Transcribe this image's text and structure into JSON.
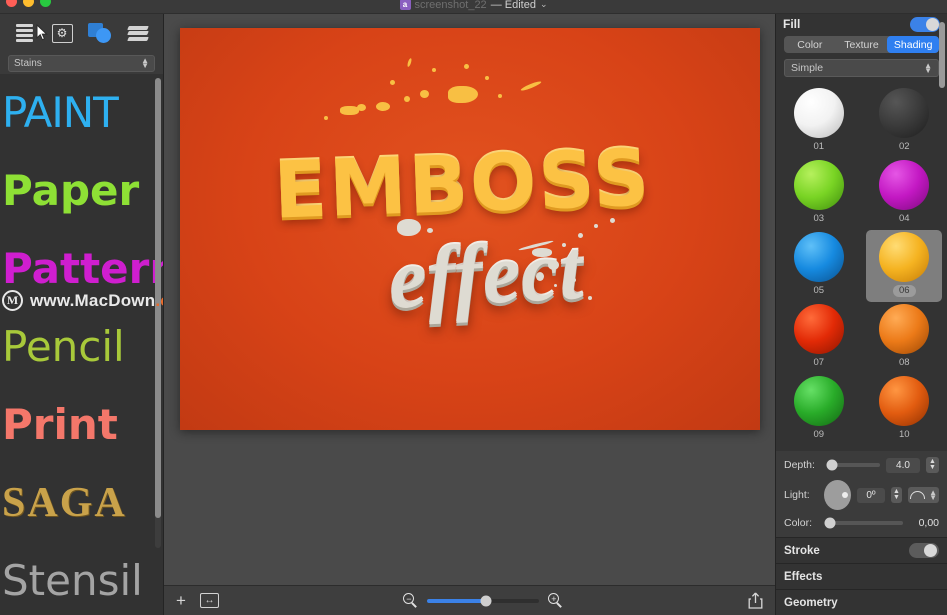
{
  "window": {
    "doc_icon_letter": "a",
    "doc_name": "screenshot_22",
    "edited_suffix": "— Edited",
    "chevron": "⌄"
  },
  "left_toolbar": {
    "icons": [
      {
        "name": "list-icon",
        "label": "List"
      },
      {
        "name": "settings-box-icon",
        "label": "Settings"
      },
      {
        "name": "shapes-icon",
        "label": "Shapes"
      },
      {
        "name": "layers-icon",
        "label": "Layers"
      }
    ]
  },
  "preset": {
    "value": "Stains",
    "stepper": "⌃⌄"
  },
  "styles": [
    {
      "label": "PAINT",
      "cls": "s-paint"
    },
    {
      "label": "Paper",
      "cls": "s-paper"
    },
    {
      "label": "Pattern",
      "cls": "s-pattern"
    },
    {
      "label": "Pencil",
      "cls": "s-pencil"
    },
    {
      "label": "Print",
      "cls": "s-print"
    },
    {
      "label": "SAGA",
      "cls": "s-saga"
    },
    {
      "label": "Stensil",
      "cls": "s-stensil"
    }
  ],
  "watermark": {
    "logo_letter": "M",
    "text": "www.MacDown",
    "tld": ".com"
  },
  "canvas": {
    "headline": "EMBOSS",
    "subline": "effect",
    "background_color": "#d84317",
    "headline_color": "#fcc244",
    "subline_color": "#dedbd2"
  },
  "bottom_bar": {
    "add_label": "+",
    "fit_label": "↔",
    "zoom_out_sign": "−",
    "zoom_in_sign": "+",
    "zoom_percent": 52,
    "share_label": "Share"
  },
  "inspector": {
    "fill": {
      "title": "Fill",
      "enabled": true,
      "tabs": [
        {
          "label": "Color",
          "active": false
        },
        {
          "label": "Texture",
          "active": false
        },
        {
          "label": "Shading",
          "active": true
        }
      ],
      "preset_value": "Simple",
      "preset_stepper": "⌃⌄",
      "swatches": [
        {
          "id": "01",
          "selected": false,
          "color": "#f2f2f2",
          "hl": "#ffffff",
          "sh": "#b9b9b9"
        },
        {
          "id": "02",
          "selected": false,
          "color": "#3b3b3b",
          "hl": "#565656",
          "sh": "#1d1d1d"
        },
        {
          "id": "03",
          "selected": false,
          "color": "#79d424",
          "hl": "#b6f05d",
          "sh": "#3e8b0d"
        },
        {
          "id": "04",
          "selected": false,
          "color": "#c318c3",
          "hl": "#e556e5",
          "sh": "#7c0a7c"
        },
        {
          "id": "05",
          "selected": false,
          "color": "#168ae0",
          "hl": "#5fc0f8",
          "sh": "#0a4f8c"
        },
        {
          "id": "06",
          "selected": true,
          "color": "#f5b321",
          "hl": "#ffdc74",
          "sh": "#c47a06"
        },
        {
          "id": "07",
          "selected": false,
          "color": "#e22a06",
          "hl": "#ff6b3a",
          "sh": "#8c1500"
        },
        {
          "id": "08",
          "selected": false,
          "color": "#ec7a18",
          "hl": "#ffab55",
          "sh": "#9a4604"
        },
        {
          "id": "09",
          "selected": false,
          "color": "#29ac29",
          "hl": "#66e066",
          "sh": "#136513"
        },
        {
          "id": "10",
          "selected": false,
          "color": "#e25c10",
          "hl": "#ff9642",
          "sh": "#8e2f00"
        }
      ],
      "controls": {
        "depth": {
          "label": "Depth:",
          "value": "4.0",
          "fill_percent": 8
        },
        "light": {
          "label": "Light:",
          "angle": "0º",
          "arc": "arc"
        },
        "color": {
          "label": "Color:",
          "value": "0,00",
          "fill_percent": 2
        }
      }
    },
    "sections": [
      {
        "title": "Stroke",
        "has_toggle": true,
        "enabled": false
      },
      {
        "title": "Effects",
        "has_toggle": false,
        "enabled": false
      },
      {
        "title": "Geometry",
        "has_toggle": false,
        "enabled": false
      }
    ]
  }
}
